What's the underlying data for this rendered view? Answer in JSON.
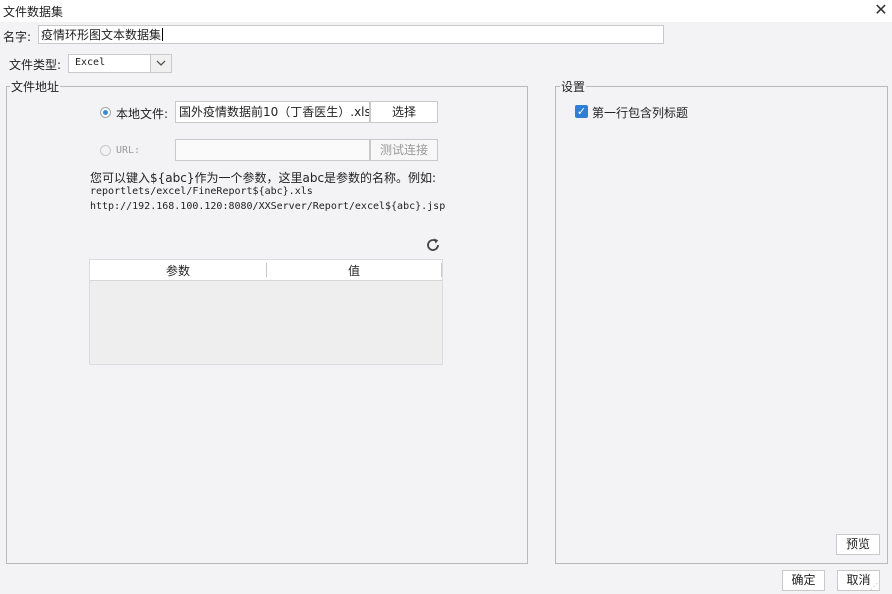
{
  "window": {
    "title": "文件数据集",
    "close_icon": "close-icon"
  },
  "name": {
    "label": "名字:",
    "value": "疫情环形图文本数据集"
  },
  "file_type": {
    "label": "文件类型:",
    "selected": "Excel"
  },
  "file_address": {
    "legend": "文件地址",
    "local": {
      "label": "本地文件:",
      "value": "国外疫情数据前10（丁香医生）.xls",
      "selected": true,
      "button": "选择"
    },
    "url": {
      "label": "URL:",
      "value": "",
      "selected": false,
      "button": "测试连接"
    },
    "hint": {
      "line1": "您可以键入${abc}作为一个参数，这里abc是参数的名称。例如:",
      "line2": "reportlets/excel/FineReport${abc}.xls",
      "line3": "http://192.168.100.120:8080/XXServer/Report/excel${abc}.jsp"
    },
    "refresh_icon": "refresh-icon",
    "params_table": {
      "columns": [
        "参数",
        "值"
      ],
      "rows": []
    }
  },
  "settings": {
    "legend": "设置",
    "first_row_header": {
      "label": "第一行包含列标题",
      "checked": true
    },
    "preview_button": "预览"
  },
  "footer": {
    "ok": "确定",
    "cancel": "取消"
  },
  "colors": {
    "accent": "#2f7fd6",
    "background": "#f3f3f5"
  }
}
